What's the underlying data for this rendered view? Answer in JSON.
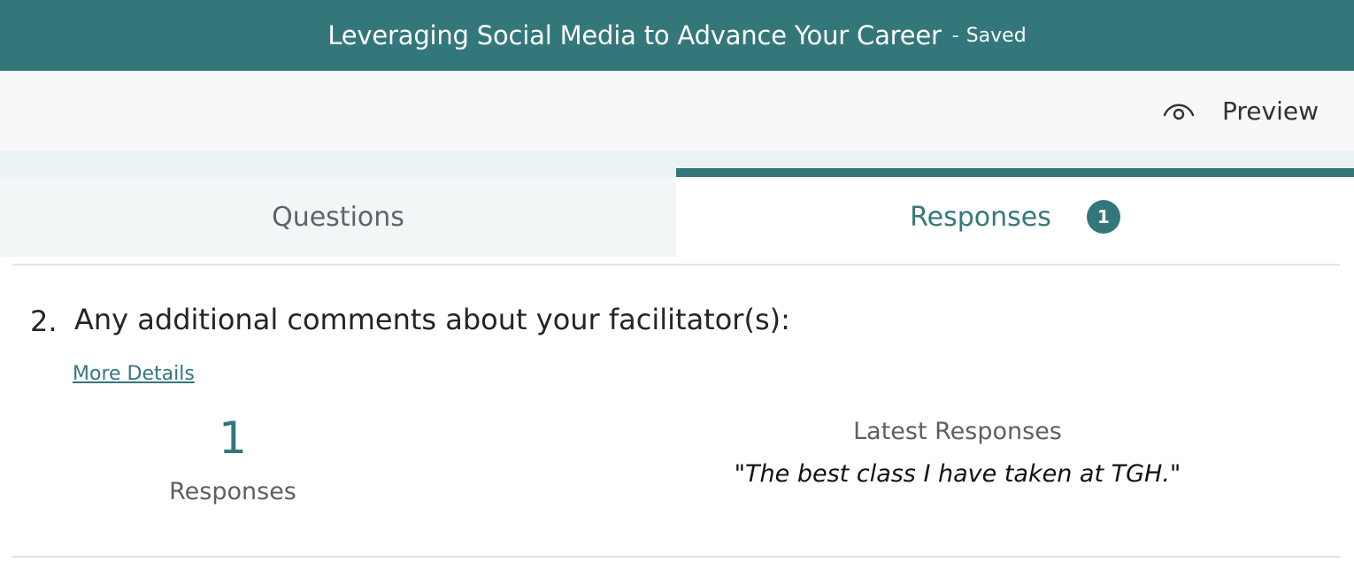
{
  "header": {
    "title": "Leveraging Social Media to Advance Your Career",
    "separator": "-",
    "status": "Saved"
  },
  "command_bar": {
    "preview_label": "Preview",
    "preview_icon": "eye-icon"
  },
  "tabs": {
    "questions_label": "Questions",
    "responses_label": "Responses",
    "responses_badge": "1",
    "active": "responses"
  },
  "question": {
    "number": "2.",
    "text": "Any additional comments about your facilitator(s):",
    "more_details": "More Details",
    "response_count": "1",
    "response_count_label": "Responses",
    "latest_title": "Latest Responses",
    "latest_responses": [
      "\"The best class I have taken at TGH.\""
    ]
  },
  "colors": {
    "accent": "#34777b",
    "header_bg": "#34777b",
    "command_bar_bg": "#f8f8f8"
  }
}
